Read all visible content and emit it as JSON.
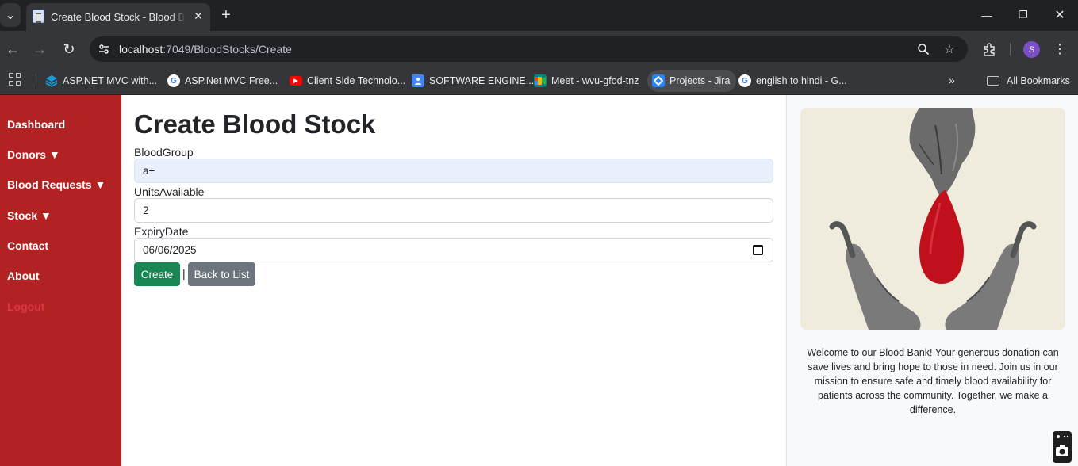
{
  "browser": {
    "tab_title": "Create Blood Stock - Blood Bank",
    "url_host": "localhost",
    "url_rest": ":7049/BloodStocks/Create",
    "profile_initial": "S",
    "bookmarks": [
      {
        "label": "ASP.NET MVC with...",
        "icon": "layers-icon",
        "color": "#1a9bd7"
      },
      {
        "label": "ASP.Net MVC Free...",
        "icon": "google-icon",
        "color": "#ffffff"
      },
      {
        "label": "Client Side Technolo...",
        "icon": "youtube-icon",
        "color": "#ff0000"
      },
      {
        "label": "SOFTWARE ENGINE...",
        "icon": "classroom-icon",
        "color": "#4285f4"
      },
      {
        "label": "Meet - wvu-gfod-tnz",
        "icon": "meet-icon",
        "color": "#00897b"
      },
      {
        "label": "Projects - Jira",
        "icon": "jira-icon",
        "color": "#2684ff"
      },
      {
        "label": "english to hindi - G...",
        "icon": "google-icon",
        "color": "#ffffff"
      }
    ],
    "all_bookmarks": "All Bookmarks"
  },
  "sidebar": {
    "items": [
      {
        "label": "Dashboard"
      },
      {
        "label": "Donors ▼"
      },
      {
        "label": "Blood Requests ▼"
      },
      {
        "label": "Stock ▼"
      },
      {
        "label": "Contact"
      },
      {
        "label": "About"
      },
      {
        "label": "Logout"
      }
    ],
    "colors": {
      "background": "#b22222",
      "logout": "#dc3545"
    }
  },
  "form": {
    "title": "Create Blood Stock",
    "fields": [
      {
        "label": "BloodGroup",
        "value": "a+"
      },
      {
        "label": "UnitsAvailable",
        "value": "2"
      },
      {
        "label": "ExpiryDate",
        "value": "06/06/2025"
      }
    ],
    "create_label": "Create",
    "separator": "|",
    "back_label": "Back to List",
    "colors": {
      "create": "#198754",
      "back": "#6c757d"
    }
  },
  "aside": {
    "welcome_text": "Welcome to our Blood Bank! Your generous donation can save lives and bring hope to those in need. Join us in our mission to ensure safe and timely blood availability for patients across the community. Together, we make a difference."
  }
}
